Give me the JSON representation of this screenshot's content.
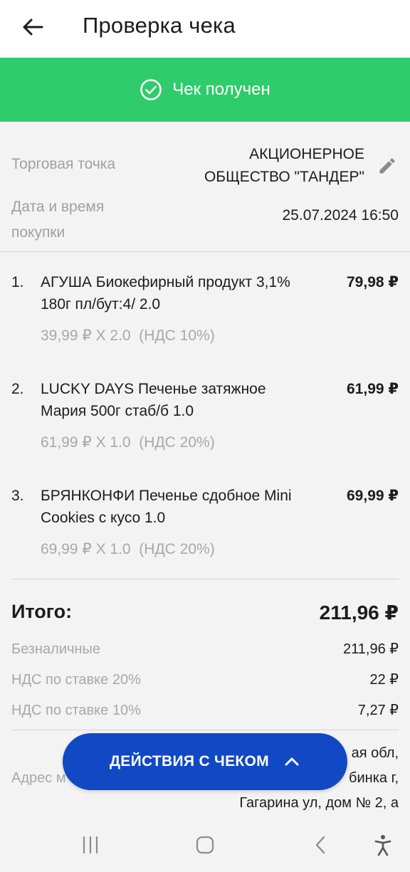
{
  "appbar": {
    "title": "Проверка чека"
  },
  "banner": {
    "text": "Чек получен",
    "color": "#2ecc6a"
  },
  "store": {
    "label": "Торговая точка",
    "value_line1": "АКЦИОНЕРНОЕ",
    "value_line2": "ОБЩЕСТВО \"ТАНДЕР\""
  },
  "purchase_date": {
    "label_line1": "Дата и время",
    "label_line2": "покупки",
    "value": "25.07.2024 16:50"
  },
  "items": [
    {
      "num": "1.",
      "name": "АГУША Биокефирный продукт 3,1% 180г пл/бут:4/ 2.0",
      "sub": "39,99 ₽ X 2.0  (НДС 10%)",
      "price": "79,98 ₽"
    },
    {
      "num": "2.",
      "name": "LUCKY DAYS Печенье затяжное Мария 500г стаб/б 1.0",
      "sub": "61,99 ₽ X 1.0  (НДС 20%)",
      "price": "61,99 ₽"
    },
    {
      "num": "3.",
      "name": "БРЯНКОНФИ Печенье сдобное Mini Cookies с кусо 1.0",
      "sub": "69,99 ₽ X 1.0  (НДС 20%)",
      "price": "69,99 ₽"
    }
  ],
  "totals": {
    "total_label": "Итого:",
    "total_value": "211,96 ₽",
    "cashless_label": "Безналичные",
    "cashless_value": "211,96 ₽",
    "vat20_label": "НДС по ставке 20%",
    "vat20_value": "22 ₽",
    "vat10_label": "НДС по ставке 10%",
    "vat10_value": "7,27 ₽"
  },
  "address": {
    "label": "Адрес м",
    "line1": "ая обл,",
    "line2": "бинка г,",
    "line3": "Гагарина ул, дом № 2,  а"
  },
  "actions_button": {
    "label": "ДЕЙСТВИЯ С ЧЕКОМ",
    "color": "#1149c4",
    "icon": "chevron-up-icon"
  },
  "icons": {
    "back": "arrow-left-icon",
    "check": "check-circle-icon",
    "edit": "pencil-icon",
    "recents": "recents-icon",
    "home": "home-icon",
    "nav_back": "nav-back-icon",
    "accessibility": "accessibility-icon"
  }
}
